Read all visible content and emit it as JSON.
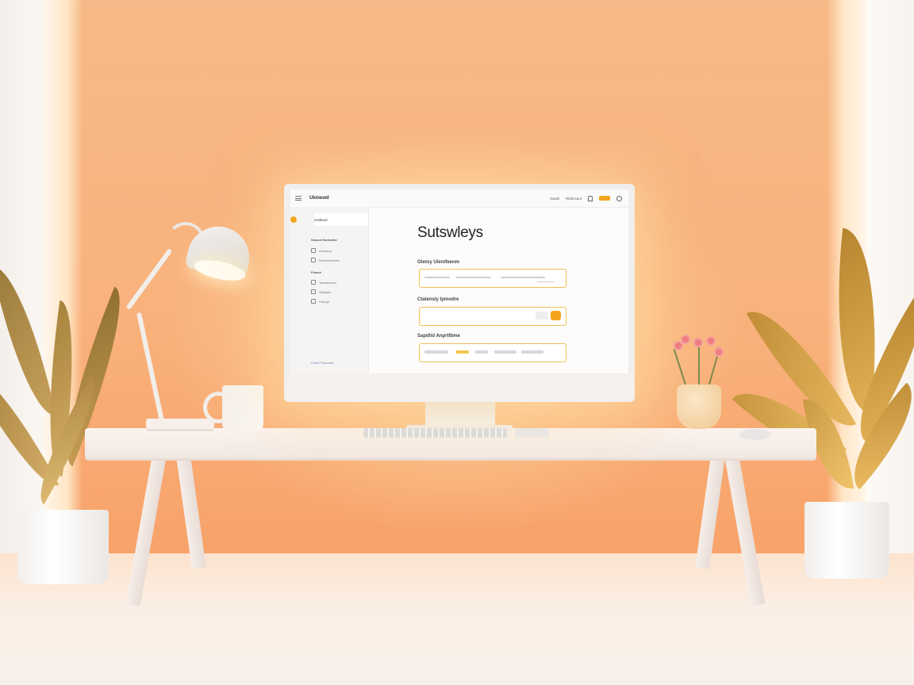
{
  "app": {
    "brand": "Ukmewd",
    "title": "Sutswleys",
    "subtitle": "",
    "accent": "#f3a41f"
  },
  "topbar": {
    "links": [
      "Sawtil",
      "Rlatinsant"
    ],
    "button_label": "",
    "icons": [
      "menu-icon",
      "bell-icon",
      "user-icon"
    ]
  },
  "sidebar": {
    "active_item": "Sottleed",
    "sections": [
      {
        "title": "Seasot Honlotine",
        "items": [
          "Gnewlng",
          "Bmohtenentes"
        ]
      },
      {
        "title": "Fsseut",
        "items": [
          "Tausbanoert",
          "Sttkaske",
          "Hedrgs"
        ]
      }
    ],
    "footer": "Hettal Timeanke"
  },
  "form": {
    "fields": [
      {
        "label": "Gtetsy Ulentfeenm"
      },
      {
        "label": "Ctatensly Ipmodre"
      },
      {
        "label": "Sapdtid Anprtfbme"
      }
    ]
  },
  "colors": {
    "wall": "#f9b27c",
    "accent": "#f3a41f",
    "input_border": "#f0c058"
  }
}
